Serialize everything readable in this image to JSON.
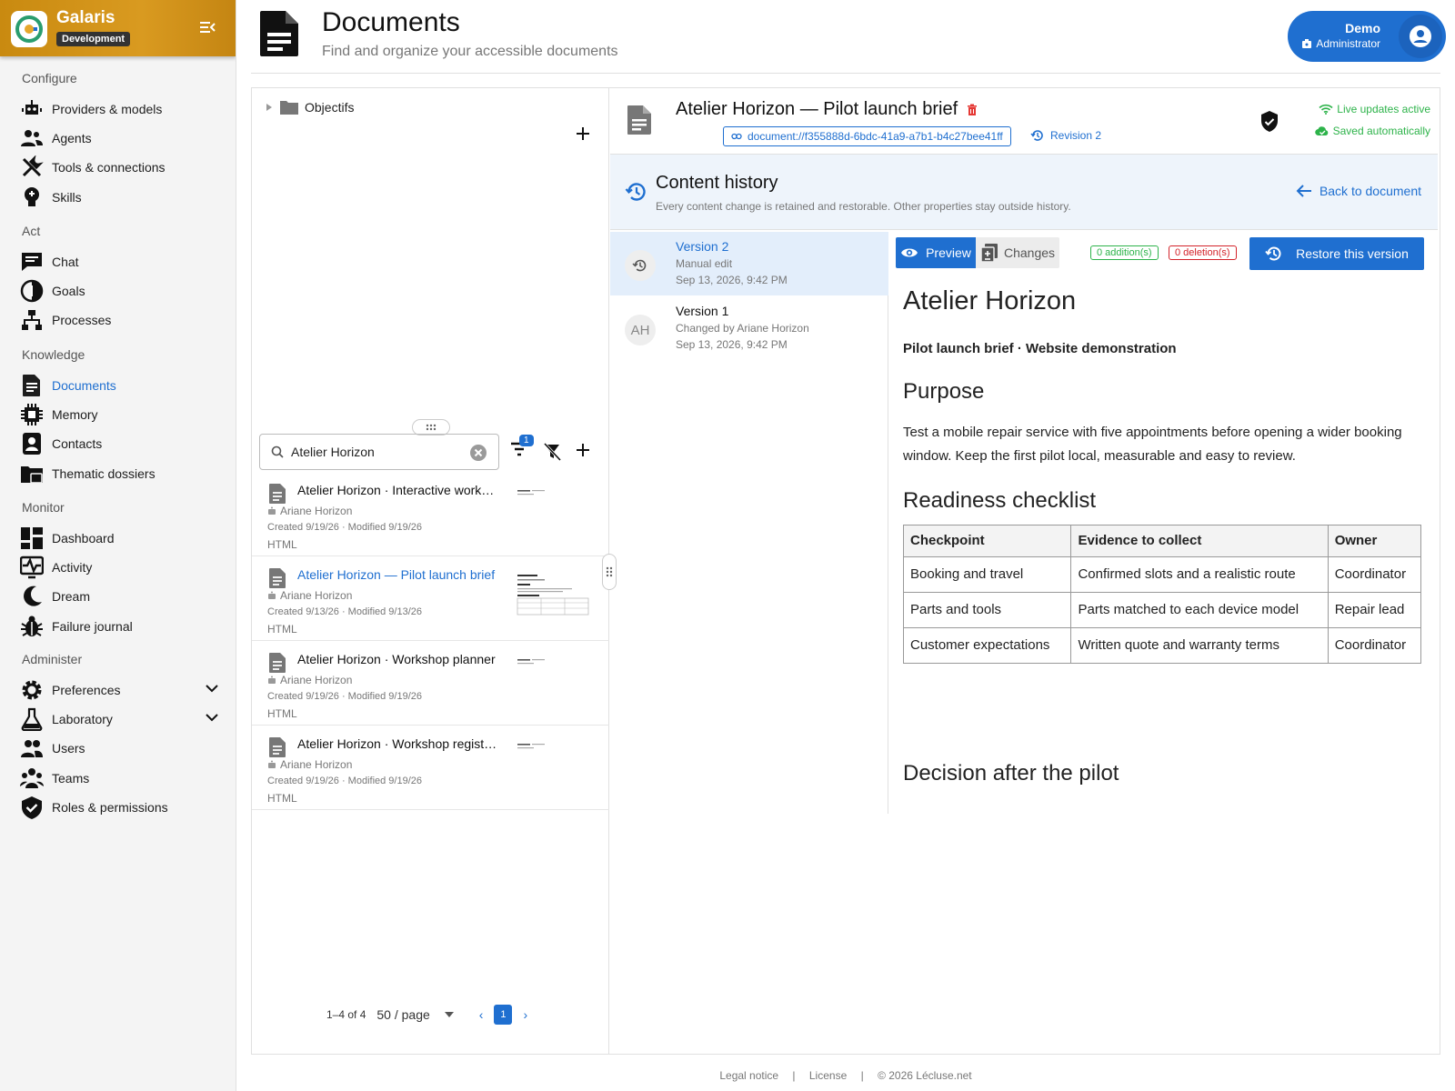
{
  "app": {
    "name": "Galaris",
    "env": "Development"
  },
  "sidebar": {
    "sections": [
      {
        "label": "Configure",
        "items": [
          {
            "label": "Providers & models",
            "icon": "robot-icon"
          },
          {
            "label": "Agents",
            "icon": "group-icon"
          },
          {
            "label": "Tools & connections",
            "icon": "tools-icon"
          },
          {
            "label": "Skills",
            "icon": "lightbulb-icon"
          }
        ]
      },
      {
        "label": "Act",
        "items": [
          {
            "label": "Chat",
            "icon": "chat-icon"
          },
          {
            "label": "Goals",
            "icon": "goal-icon"
          },
          {
            "label": "Processes",
            "icon": "process-icon"
          }
        ]
      },
      {
        "label": "Knowledge",
        "items": [
          {
            "label": "Documents",
            "icon": "document-icon",
            "active": true
          },
          {
            "label": "Memory",
            "icon": "chip-icon"
          },
          {
            "label": "Contacts",
            "icon": "contact-icon"
          },
          {
            "label": "Thematic dossiers",
            "icon": "folder-icon"
          }
        ]
      },
      {
        "label": "Monitor",
        "items": [
          {
            "label": "Dashboard",
            "icon": "dashboard-icon"
          },
          {
            "label": "Activity",
            "icon": "activity-icon"
          },
          {
            "label": "Dream",
            "icon": "moon-icon"
          },
          {
            "label": "Failure journal",
            "icon": "bug-icon"
          }
        ]
      },
      {
        "label": "Administer",
        "items": [
          {
            "label": "Preferences",
            "icon": "gear-icon",
            "expandable": true
          },
          {
            "label": "Laboratory",
            "icon": "flask-icon",
            "expandable": true
          },
          {
            "label": "Users",
            "icon": "users-icon"
          },
          {
            "label": "Teams",
            "icon": "teams-icon"
          },
          {
            "label": "Roles & permissions",
            "icon": "shield-icon"
          }
        ]
      }
    ]
  },
  "header": {
    "title": "Documents",
    "subtitle": "Find and organize your accessible documents"
  },
  "user": {
    "name": "Demo",
    "role": "Administrator"
  },
  "tree": {
    "folder": "Objectifs"
  },
  "search": {
    "value": "Atelier Horizon",
    "filter_count": "1"
  },
  "documents": [
    {
      "title": "Atelier Horizon · Interactive workshop",
      "author": "Ariane Horizon",
      "dates": "Created 9/19/26 · Modified 9/19/26",
      "type": "HTML",
      "selected": false
    },
    {
      "title": "Atelier Horizon — Pilot launch brief",
      "author": "Ariane Horizon",
      "dates": "Created 9/13/26 · Modified 9/13/26",
      "type": "HTML",
      "selected": true
    },
    {
      "title": "Atelier Horizon · Workshop planner",
      "author": "Ariane Horizon",
      "dates": "Created 9/19/26 · Modified 9/19/26",
      "type": "HTML",
      "selected": false
    },
    {
      "title": "Atelier Horizon · Workshop registration",
      "author": "Ariane Horizon",
      "dates": "Created 9/19/26 · Modified 9/19/26",
      "type": "HTML",
      "selected": false
    }
  ],
  "pager": {
    "range": "1–4 of 4",
    "size": "50 / page",
    "page": "1"
  },
  "doc": {
    "title": "Atelier Horizon — Pilot launch brief",
    "uri": "document://f355888d-6bdc-41a9-a7b1-b4c27bee41ff",
    "revision": "Revision 2",
    "live": "Live updates active",
    "saved": "Saved automatically"
  },
  "history": {
    "title": "Content history",
    "subtitle": "Every content change is retained and restorable. Other properties stay outside history.",
    "back": "Back to document",
    "versions": [
      {
        "name": "Version 2",
        "note": "Manual edit",
        "date": "Sep 13, 2026, 9:42 PM",
        "avatar": "",
        "selected": true
      },
      {
        "name": "Version 1",
        "note": "Changed by Ariane Horizon",
        "date": "Sep 13, 2026, 9:42 PM",
        "avatar": "AH",
        "selected": false
      }
    ],
    "preview_label": "Preview",
    "changes_label": "Changes",
    "additions": "0 addition(s)",
    "deletions": "0 deletion(s)",
    "restore_label": "Restore this version"
  },
  "preview": {
    "h1": "Atelier Horizon",
    "lead": "Pilot launch brief · Website demonstration",
    "h2_purpose": "Purpose",
    "purpose": "Test a mobile repair service with five appointments before opening a wider booking window. Keep the first pilot local, measurable and easy to review.",
    "h2_checklist": "Readiness checklist",
    "table": {
      "headers": [
        "Checkpoint",
        "Evidence to collect",
        "Owner"
      ],
      "rows": [
        [
          "Booking and travel",
          "Confirmed slots and a realistic route",
          "Coordinator"
        ],
        [
          "Parts and tools",
          "Parts matched to each device model",
          "Repair lead"
        ],
        [
          "Customer expectations",
          "Written quote and warranty terms",
          "Coordinator"
        ]
      ]
    },
    "h2_decision": "Decision after the pilot"
  },
  "footer": {
    "legal": "Legal notice",
    "sep": "|",
    "license": "License",
    "copyright": "© 2026 Lécluse.net"
  },
  "colors": {
    "accent": "#1f6fd0",
    "brand": "#d39417",
    "success": "#2db34a",
    "danger": "#d3232a"
  }
}
